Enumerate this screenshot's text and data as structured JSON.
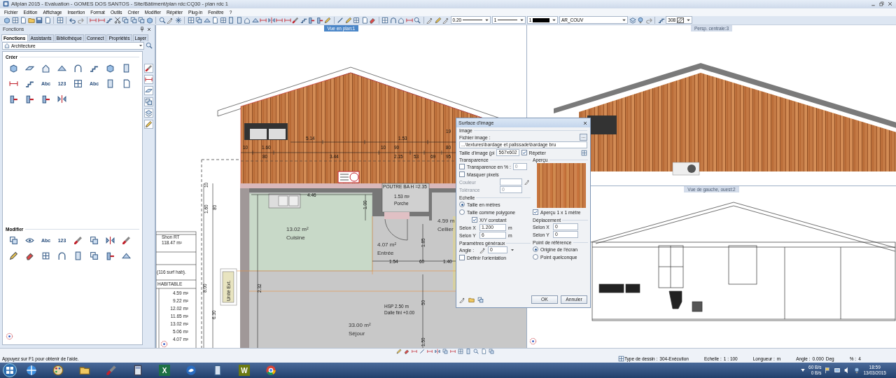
{
  "window": {
    "title": "Allplan 2015 - Evaluation - GOMES DOS SANTOS - Site/Bâtiment/plan rdc:CQ30 - plan rdc 1"
  },
  "menu": [
    "Fichier",
    "Edition",
    "Affichage",
    "Insertion",
    "Format",
    "Outils",
    "Créer",
    "Modifier",
    "Répéter",
    "Plug-in",
    "Fenêtre",
    "?"
  ],
  "toolbar": [
    {
      "kind": "icon"
    },
    {
      "kind": "icon"
    },
    {
      "kind": "icon"
    },
    {
      "kind": "icon"
    },
    {
      "kind": "icon"
    },
    {
      "kind": "icon"
    },
    {
      "kind": "sep"
    },
    {
      "kind": "icon"
    },
    {
      "kind": "sep"
    },
    {
      "kind": "icon"
    },
    {
      "kind": "icon"
    },
    {
      "kind": "sep"
    },
    {
      "kind": "icon"
    },
    {
      "kind": "icon"
    },
    {
      "kind": "icon"
    },
    {
      "kind": "icon"
    },
    {
      "kind": "icon"
    },
    {
      "kind": "icon"
    },
    {
      "kind": "icon"
    },
    {
      "kind": "icon"
    },
    {
      "kind": "sep"
    },
    {
      "kind": "icon"
    },
    {
      "kind": "icon"
    },
    {
      "kind": "icon"
    },
    {
      "kind": "sep"
    },
    {
      "kind": "icon"
    },
    {
      "kind": "icon"
    },
    {
      "kind": "icon"
    },
    {
      "kind": "icon"
    },
    {
      "kind": "icon"
    },
    {
      "kind": "icon"
    },
    {
      "kind": "icon"
    },
    {
      "kind": "icon"
    },
    {
      "kind": "icon"
    },
    {
      "kind": "icon"
    },
    {
      "kind": "icon"
    },
    {
      "kind": "icon"
    },
    {
      "kind": "icon"
    },
    {
      "kind": "icon"
    },
    {
      "kind": "icon"
    },
    {
      "kind": "icon"
    },
    {
      "kind": "icon"
    },
    {
      "kind": "icon"
    },
    {
      "kind": "sep"
    },
    {
      "kind": "icon"
    },
    {
      "kind": "icon"
    },
    {
      "kind": "icon"
    },
    {
      "kind": "icon"
    },
    {
      "kind": "icon"
    },
    {
      "kind": "sep"
    },
    {
      "kind": "icon"
    },
    {
      "kind": "icon"
    },
    {
      "kind": "icon"
    },
    {
      "kind": "icon"
    },
    {
      "kind": "icon"
    },
    {
      "kind": "sep"
    },
    {
      "kind": "icon"
    },
    {
      "kind": "icon"
    },
    {
      "kind": "icon"
    },
    {
      "kind": "linecombo",
      "value": "0.20"
    },
    {
      "kind": "linecombo",
      "value": "1"
    },
    {
      "kind": "colorcombo",
      "value": "1"
    },
    {
      "kind": "combo",
      "value": "AR_COUV"
    },
    {
      "kind": "icon"
    },
    {
      "kind": "icon"
    },
    {
      "kind": "icon"
    },
    {
      "kind": "sep"
    },
    {
      "kind": "icon"
    },
    {
      "kind": "hatchcombo",
      "value": "308"
    }
  ],
  "panel": {
    "title": "Fonctions",
    "tabs": [
      {
        "label": "Fonctions",
        "selected": true
      },
      {
        "label": "Assistants",
        "selected": false
      },
      {
        "label": "Bibliothèque",
        "selected": false
      },
      {
        "label": "Connect",
        "selected": false
      },
      {
        "label": "Propriétés",
        "selected": false
      },
      {
        "label": "Layer",
        "selected": false
      }
    ],
    "family": "Architecture",
    "sections": [
      {
        "title": "Créer",
        "tools": [
          {
            "kind": "icon"
          },
          {
            "kind": "icon"
          },
          {
            "kind": "icon"
          },
          {
            "kind": "icon"
          },
          {
            "kind": "icon"
          },
          {
            "kind": "icon"
          },
          {
            "kind": "icon"
          },
          {
            "kind": "icon"
          },
          {
            "kind": "icon"
          },
          {
            "kind": "icon"
          },
          {
            "kind": "text",
            "label": "Abc"
          },
          {
            "kind": "text",
            "label": "123"
          },
          {
            "kind": "icon"
          },
          {
            "kind": "text",
            "label": "Abc"
          },
          {
            "kind": "icon"
          },
          {
            "kind": "icon"
          },
          {
            "kind": "icon"
          },
          {
            "kind": "icon"
          },
          {
            "kind": "icon"
          },
          {
            "kind": "icon"
          }
        ]
      },
      {
        "title": "Modifier",
        "tools": [
          {
            "kind": "icon"
          },
          {
            "kind": "icon"
          },
          {
            "kind": "text",
            "label": "Abc"
          },
          {
            "kind": "text",
            "label": "123"
          },
          {
            "kind": "icon"
          },
          {
            "kind": "icon"
          },
          {
            "kind": "icon"
          },
          {
            "kind": "icon"
          },
          {
            "kind": "icon"
          },
          {
            "kind": "icon"
          },
          {
            "kind": "icon"
          },
          {
            "kind": "icon"
          },
          {
            "kind": "icon"
          },
          {
            "kind": "icon"
          },
          {
            "kind": "icon"
          },
          {
            "kind": "icon"
          }
        ]
      }
    ]
  },
  "plan": {
    "title": "Vue en plan:1",
    "active": true,
    "facade_dims": [
      "19",
      "5.14",
      "1.53",
      "10",
      "1.60",
      "10",
      "90",
      "80",
      "80",
      "3.44",
      "2.15",
      "53",
      "69",
      "95"
    ],
    "porch": {
      "label": "POUTRE BA H =2.35",
      "area": "1.53 m²",
      "name": "Porche"
    },
    "rooms": [
      {
        "area": "13.02 m²",
        "name": "Cuisine"
      },
      {
        "area": "4.07 m²",
        "name": "Entrée"
      },
      {
        "area": "4.59 m",
        "name": "Cellier"
      },
      {
        "area": "33.00 m²",
        "name": "Séjour"
      }
    ],
    "plan_dims": [
      "4.46",
      "1.00",
      "1.54",
      "60",
      "1.85",
      "1.40",
      "50",
      "1.50",
      "2.32",
      "8.00",
      "6.30",
      "1.60",
      "80",
      "10"
    ],
    "notes": [
      "HSP 2.50 m",
      "Dalle fini +0.00"
    ],
    "outdoor_unit": "Unité Ext.",
    "table": {
      "rows": [
        "Shon RT",
        "118.47 m²",
        "(116 surf hab).",
        "HABITABLE"
      ],
      "areas": [
        "4.59 m²",
        "9.22 m²",
        "12.02 m²",
        "11.65 m²",
        "13.02 m²",
        "5.06 m²",
        "4.07 m²"
      ]
    }
  },
  "perspective": {
    "title": "Persp. centrale:3",
    "active": false
  },
  "side_view": {
    "title": "Vue de gauche, ouest:2",
    "active": false
  },
  "dialog": {
    "title": "Surface d'image",
    "image": {
      "title": "Image",
      "file_label": "Fichier image :",
      "file_value": "...\\textures\\bardage et palissade\\bardage bru",
      "browse": "...",
      "size_label": "Taille d'image (pi",
      "size_value": "567x602",
      "repeat": {
        "label": "Répéter",
        "checked": true
      }
    },
    "transparency": {
      "title": "Transparence",
      "percent": {
        "label": "Transparence en % :",
        "checked": false,
        "value": "0"
      },
      "mask": {
        "label": "Masquer pixels",
        "checked": false
      },
      "color_label": "Couleur",
      "tolerance_label": "Tolérance",
      "tolerance_value": "0",
      "disabled": true
    },
    "scale": {
      "title": "Echelle",
      "options": [
        {
          "label": "Taille en mètres",
          "selected": true
        },
        {
          "label": "Taille comme polygone",
          "selected": false
        }
      ],
      "xy_constant": {
        "label": "X/Y constant",
        "checked": true
      },
      "fields": [
        {
          "label": "Selon X",
          "value": "1.200",
          "unit": "m"
        },
        {
          "label": "Selon Y",
          "value": "6",
          "unit": "m"
        }
      ]
    },
    "general": {
      "title": "Paramètres généraux",
      "angle_label": "Angle :",
      "angle_value": "0",
      "orientation": {
        "label": "Définir l'orientation",
        "checked": false
      }
    },
    "preview": {
      "title": "Aperçu",
      "one_meter": {
        "label": "Aperçu 1 x 1 mètre",
        "checked": true
      }
    },
    "offset": {
      "title": "Déplacement",
      "fields": [
        {
          "label": "Selon X",
          "value": "0"
        },
        {
          "label": "Selon Y",
          "value": "0"
        }
      ]
    },
    "reference": {
      "title": "Point de référence",
      "options": [
        {
          "label": "Origine de l'écran",
          "selected": true
        },
        {
          "label": "Point quelconque",
          "selected": false
        }
      ]
    },
    "buttons": [
      "OK",
      "Annuler"
    ]
  },
  "status": {
    "hint": "Appuyez sur F1 pour obtenir de l'aide.",
    "fields": [
      {
        "label": "Type de dessin :",
        "value": "304-Exécution"
      },
      {
        "label": "Echelle :",
        "value": "1 : 100"
      },
      {
        "label": "Longueur :",
        "unit": "m"
      },
      {
        "label": "Angle :",
        "value": "0.000",
        "unit": "Deg"
      },
      {
        "label": "% :",
        "value": "4"
      }
    ]
  },
  "taskbar": {
    "apps": [
      {
        "kind": "icon"
      },
      {
        "kind": "icon"
      },
      {
        "kind": "icon"
      },
      {
        "kind": "icon"
      },
      {
        "kind": "icon"
      },
      {
        "kind": "tile",
        "label": "X",
        "color": "#1e7145"
      },
      {
        "kind": "icon"
      },
      {
        "kind": "icon"
      },
      {
        "kind": "tile",
        "label": "W",
        "color": "#6b7a12"
      },
      {
        "kind": "icon"
      }
    ],
    "net": [
      "60 B/s",
      "0 B/s"
    ],
    "time": "18:59",
    "date": "13/03/2015"
  }
}
